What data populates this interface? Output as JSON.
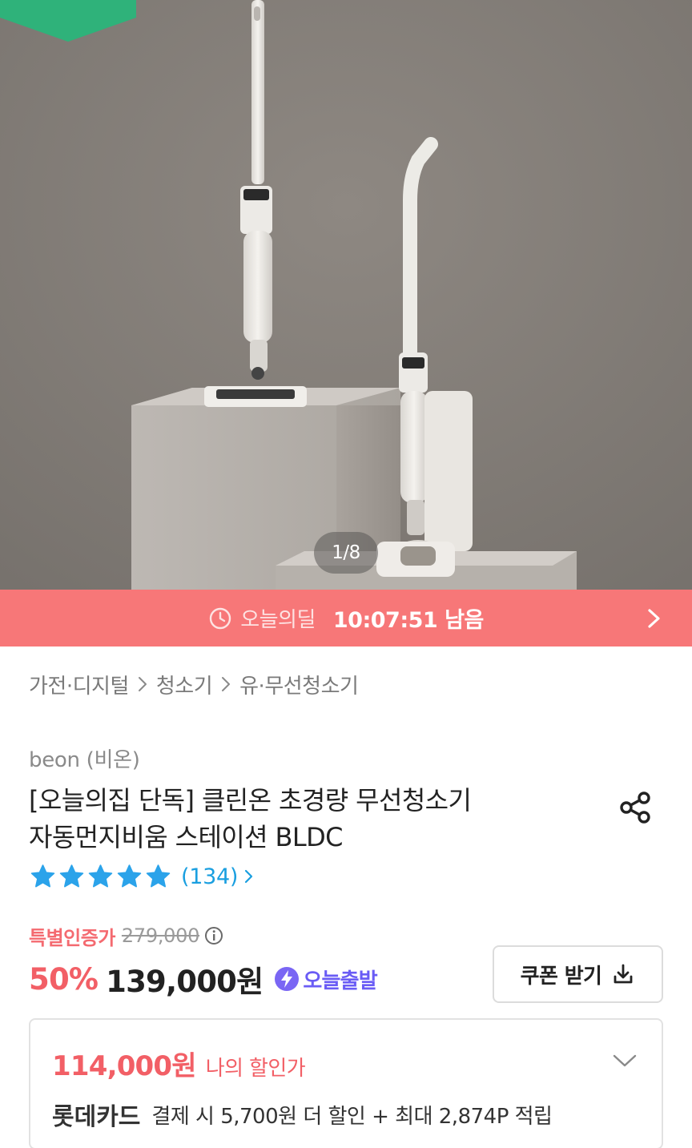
{
  "gallery": {
    "counter": "1/8",
    "colors": {
      "background": "#86807a",
      "badge": "#2fb27a"
    }
  },
  "deal": {
    "label": "오늘의딜",
    "time_remaining": "10:07:51 남음",
    "clock_icon": "clock-icon",
    "arrow_icon": "chevron-right-icon",
    "color": "#f77778"
  },
  "breadcrumb": {
    "items": [
      "가전·디지털",
      "청소기",
      "유·무선청소기"
    ]
  },
  "product": {
    "brand": "beon (비온)",
    "title_line1": "[오늘의집 단독] 클린온 초경량 무선청소기",
    "title_line2": "자동먼지비움 스테이션 BLDC",
    "share_icon": "share-icon",
    "rating": {
      "stars": 5,
      "review_count": "(134)",
      "star_color": "#2ba3ea"
    }
  },
  "pricing": {
    "special_label": "특별인증가",
    "original_price": "279,000",
    "discount_rate": "50%",
    "sale_price": "139,000원",
    "today_ship_label": "오늘출발",
    "coupon_button": "쿠폰 받기",
    "accent": "#f25f66"
  },
  "my_discount": {
    "price": "114,000원",
    "label": "나의 할인가",
    "card_name": "롯데카드",
    "benefit": "결제 시 5,700원 더 할인 + 최대 2,874P 적립"
  }
}
